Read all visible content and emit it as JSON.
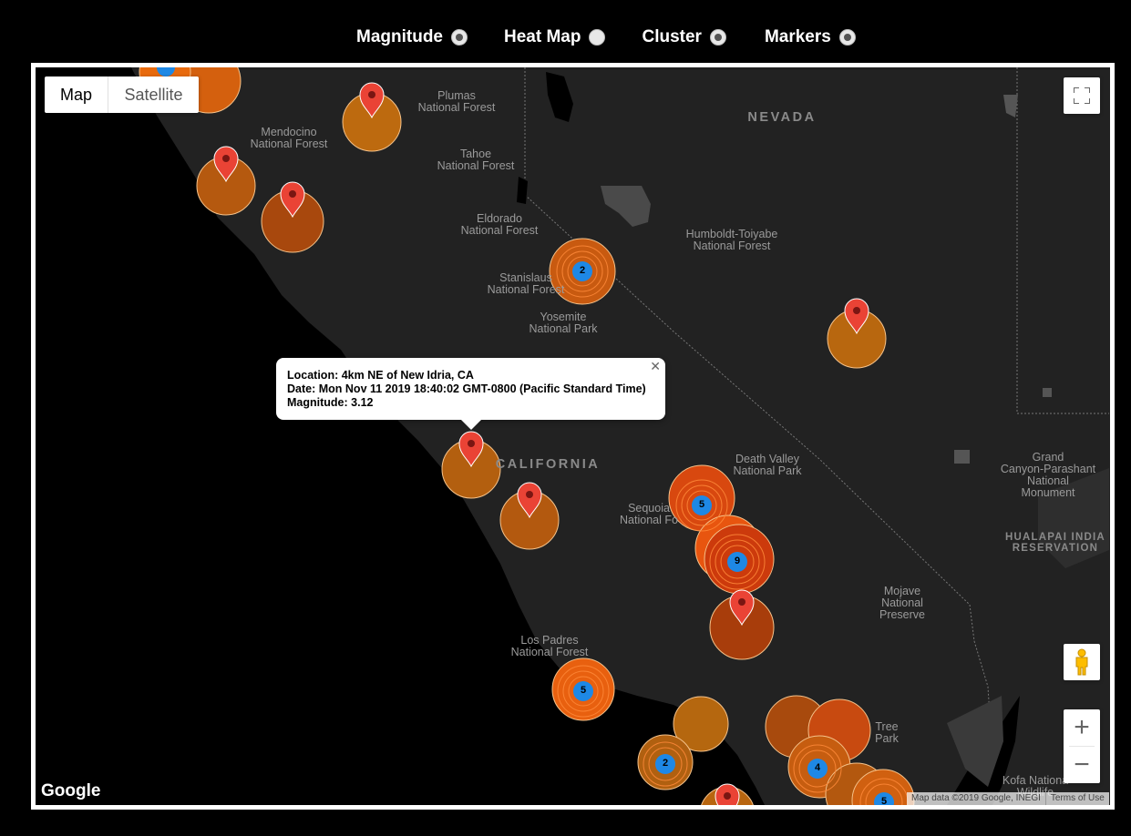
{
  "toggles": [
    {
      "label": "Magnitude",
      "checked": true
    },
    {
      "label": "Heat Map",
      "checked": false
    },
    {
      "label": "Cluster",
      "checked": true
    },
    {
      "label": "Markers",
      "checked": true
    }
  ],
  "map": {
    "map_type_options": [
      "Map",
      "Satellite"
    ],
    "selected_map_type": "Map",
    "logo": "Google",
    "attribution": "Map data ©2019 Google, INEGI",
    "terms": "Terms of Use",
    "zoom_in": "+",
    "zoom_out": "−",
    "icons": {
      "fullscreen": "fullscreen-icon",
      "pegman": "street-view-pegman-icon",
      "close": "close-icon"
    }
  },
  "labels": {
    "nevada": "NEVADA",
    "california": "CALIFORNIA",
    "plumas": [
      "Plumas",
      "National Forest"
    ],
    "mendocino": [
      "Mendocino",
      "National Forest"
    ],
    "tahoe": [
      "Tahoe",
      "National Forest"
    ],
    "eldorado": [
      "Eldorado",
      "National Forest"
    ],
    "stanislaus": [
      "Stanislaus",
      "National Forest"
    ],
    "yosemite": [
      "Yosemite",
      "National Park"
    ],
    "humboldt": [
      "Humboldt-Toiyabe",
      "National Forest"
    ],
    "death_valley": [
      "Death Valley",
      "National Park"
    ],
    "grand_canyon": [
      "Grand",
      "Canyon-Parashant",
      "National",
      "Monument"
    ],
    "hualapai": [
      "HUALAPAI INDIA",
      "RESERVATION"
    ],
    "sequoia": [
      "Sequoia",
      "National Fo"
    ],
    "mojave": [
      "Mojave",
      "National",
      "Preserve"
    ],
    "los_padres": [
      "Los Padres",
      "National Forest"
    ],
    "joshua_tree": [
      "Tree",
      "Park"
    ],
    "kofa": [
      "Kofa Nationa",
      "Wildlife"
    ]
  },
  "info_window": {
    "location_label": "Location:",
    "location": "4km NE of New Idria, CA",
    "date_label": "Date:",
    "date": "Mon Nov 11 2019 18:40:02 GMT-0800 (Pacific Standard Time)",
    "magnitude_label": "Magnitude:",
    "magnitude": "3.12"
  },
  "clusters": [
    {
      "count": "2"
    },
    {
      "count": "5"
    },
    {
      "count": "9"
    },
    {
      "count": "5"
    },
    {
      "count": "2"
    },
    {
      "count": "4"
    },
    {
      "count": "5"
    }
  ],
  "colors": {
    "marker_red": "#ea4335",
    "magnitude_orange": "#c8650f",
    "cluster_blue": "#1e88e5",
    "land": "#222222",
    "ocean": "#000000"
  }
}
